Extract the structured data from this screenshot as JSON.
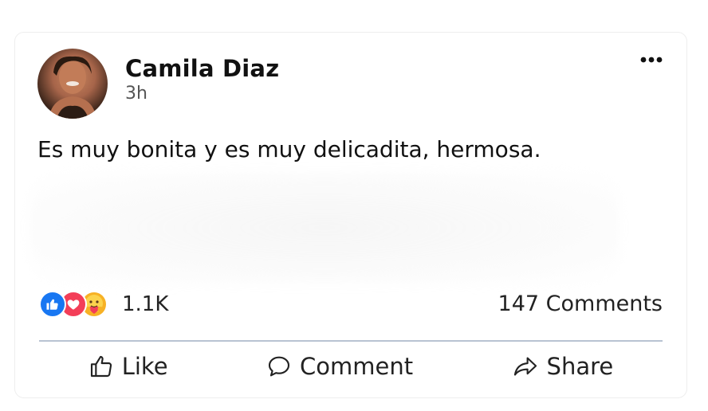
{
  "post": {
    "author": "Camila Diaz",
    "time": "3h",
    "text": "Es muy bonita y es muy delicadita, hermosa."
  },
  "reactions": {
    "icons": [
      "like-icon",
      "love-icon",
      "care-icon"
    ],
    "count": "1.1K"
  },
  "comments": {
    "count_label": "147 Comments"
  },
  "actions": {
    "like_label": "Like",
    "comment_label": "Comment",
    "share_label": "Share"
  },
  "colors": {
    "like_blue": "#1877f2",
    "love_red": "#f33e58",
    "care_yellow": "#f7b125",
    "divider": "#b8c3d2"
  }
}
